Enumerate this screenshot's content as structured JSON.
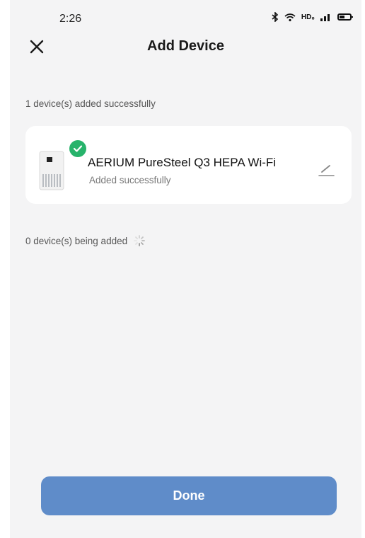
{
  "status_bar": {
    "time": "2:26",
    "icons": [
      "bluetooth-icon",
      "wifi-icon",
      "hd-icon",
      "signal-icon",
      "battery-icon"
    ],
    "hd_label": "HD₈",
    "signal_label": "ᵍᴳıl"
  },
  "header": {
    "title": "Add Device",
    "close_icon": "close-icon"
  },
  "added_section": {
    "label": "1 device(s) added successfully"
  },
  "device": {
    "name": "AERIUM PureSteel Q3 HEPA Wi-Fi",
    "status": "Added successfully",
    "status_color": "#27b36b"
  },
  "adding_section": {
    "label": "0 device(s) being added"
  },
  "actions": {
    "done_label": "Done",
    "done_color": "#5f8cc9"
  }
}
